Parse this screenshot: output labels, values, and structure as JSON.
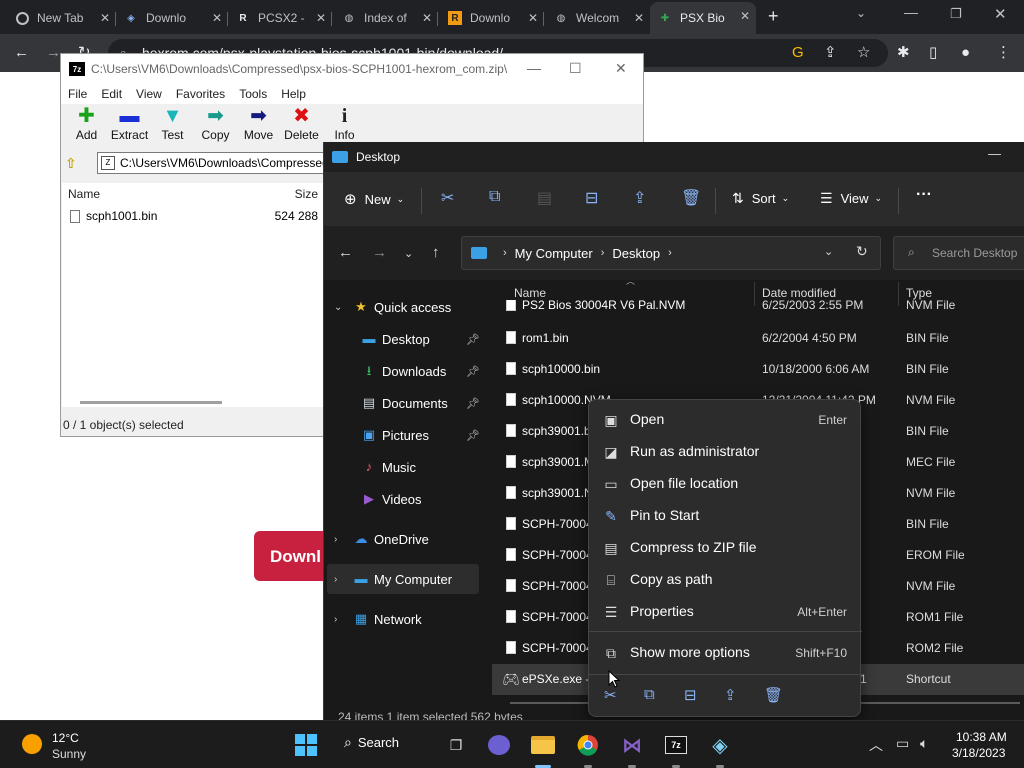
{
  "chrome": {
    "tabs": [
      {
        "label": "New Tab",
        "icon": "chrome-icon"
      },
      {
        "label": "Downlo",
        "icon": "site-icon"
      },
      {
        "label": "PCSX2 -",
        "icon": "r-icon"
      },
      {
        "label": "Index of",
        "icon": "globe-icon"
      },
      {
        "label": "Downlo",
        "icon": "r-icon"
      },
      {
        "label": "Welcom",
        "icon": "globe-icon"
      },
      {
        "label": "PSX Bio",
        "icon": "plugin-icon",
        "active": true
      }
    ],
    "url": "hexrom.com/psx-playstation-bios-scph1001-bin/download/",
    "page_button_label": "Downl"
  },
  "sevenzip": {
    "title": "C:\\Users\\VM6\\Downloads\\Compressed\\psx-bios-SCPH1001-hexrom_com.zip\\",
    "menu": [
      "File",
      "Edit",
      "View",
      "Favorites",
      "Tools",
      "Help"
    ],
    "toolbar": [
      {
        "label": "Add",
        "icon": "add-icon",
        "glyph": "✚",
        "color": "#1aa31a"
      },
      {
        "label": "Extract",
        "icon": "extract-icon",
        "glyph": "▬",
        "color": "#1a2fd6"
      },
      {
        "label": "Test",
        "icon": "test-icon",
        "glyph": "▼",
        "color": "#19b7b7"
      },
      {
        "label": "Copy",
        "icon": "copy-icon",
        "glyph": "➡",
        "color": "#1a9a8a"
      },
      {
        "label": "Move",
        "icon": "move-icon",
        "glyph": "➡",
        "color": "#141a80"
      },
      {
        "label": "Delete",
        "icon": "delete-icon",
        "glyph": "✖",
        "color": "#d11"
      },
      {
        "label": "Info",
        "icon": "info-icon",
        "glyph": "i",
        "color": "#222"
      }
    ],
    "path": "C:\\Users\\VM6\\Downloads\\Compressed",
    "columns": {
      "name": "Name",
      "size": "Size"
    },
    "files": [
      {
        "name": "scph1001.bin",
        "size": "524 288"
      }
    ],
    "status": "0 / 1 object(s) selected"
  },
  "explorer": {
    "title": "Desktop",
    "cmd": {
      "new": "New",
      "sort": "Sort",
      "view": "View"
    },
    "breadcrumb": [
      "My Computer",
      "Desktop"
    ],
    "search_placeholder": "Search Desktop",
    "pane": [
      {
        "label": "Quick access",
        "icon": "star-icon",
        "glyph": "★",
        "color": "#f2c12e"
      },
      {
        "label": "Desktop",
        "icon": "desktop-icon",
        "glyph": "▬",
        "color": "#3ba0e6",
        "pinned": true
      },
      {
        "label": "Downloads",
        "icon": "download-icon",
        "glyph": "⭳",
        "color": "#3cc46b",
        "pinned": true
      },
      {
        "label": "Documents",
        "icon": "documents-icon",
        "glyph": "▤",
        "color": "#cfd8e0",
        "pinned": true
      },
      {
        "label": "Pictures",
        "icon": "pictures-icon",
        "glyph": "▣",
        "color": "#4aa3f0",
        "pinned": true
      },
      {
        "label": "Music",
        "icon": "music-icon",
        "glyph": "♪",
        "color": "#e8627a"
      },
      {
        "label": "Videos",
        "icon": "videos-icon",
        "glyph": "▶",
        "color": "#9b59d0"
      },
      {
        "label": "OneDrive",
        "icon": "cloud-icon",
        "glyph": "☁",
        "color": "#3b8ee8"
      },
      {
        "label": "My Computer",
        "icon": "computer-icon",
        "glyph": "▬",
        "color": "#3ba0e6"
      },
      {
        "label": "Network",
        "icon": "network-icon",
        "glyph": "▦",
        "color": "#3ba0e6"
      }
    ],
    "columns": {
      "name": "Name",
      "date": "Date modified",
      "type": "Type"
    },
    "files": [
      {
        "name": "PS2 Bios 30004R V6 Pal.NVM",
        "date": "6/25/2003 2:55 PM",
        "type": "NVM File"
      },
      {
        "name": "rom1.bin",
        "date": "6/2/2004 4:50 PM",
        "type": "BIN File"
      },
      {
        "name": "scph10000.bin",
        "date": "10/18/2000 6:06 AM",
        "type": "BIN File"
      },
      {
        "name": "scph10000.NVM",
        "date": "12/21/2004 11:42 PM",
        "type": "NVM File"
      },
      {
        "name": "scph39001.b",
        "date": "",
        "type": "BIN File"
      },
      {
        "name": "scph39001.M",
        "date": "",
        "type": "MEC File"
      },
      {
        "name": "scph39001.N",
        "date": "",
        "type": "NVM File"
      },
      {
        "name": "SCPH-70004",
        "date": "",
        "type": "BIN File"
      },
      {
        "name": "SCPH-70004",
        "date": "",
        "type": "EROM File"
      },
      {
        "name": "SCPH-70004",
        "date": "",
        "type": "NVM File"
      },
      {
        "name": "SCPH-70004",
        "date": "",
        "type": "ROM1 File"
      },
      {
        "name": "SCPH-70004",
        "date": "",
        "type": "ROM2 File"
      },
      {
        "name": "ePSXe.exe - S",
        "date": "1",
        "type": "Shortcut"
      }
    ],
    "status": "24 items   1 item selected   562 bytes"
  },
  "context_menu": {
    "items": [
      {
        "label": "Open",
        "shortcut": "Enter",
        "icon": "open-icon",
        "glyph": "▣"
      },
      {
        "label": "Run as administrator",
        "shortcut": "",
        "icon": "shield-icon",
        "glyph": "◪"
      },
      {
        "label": "Open file location",
        "shortcut": "",
        "icon": "folder-icon",
        "glyph": "▭"
      },
      {
        "label": "Pin to Start",
        "shortcut": "",
        "icon": "pin-icon",
        "glyph": "✎"
      },
      {
        "label": "Compress to ZIP file",
        "shortcut": "",
        "icon": "zip-icon",
        "glyph": "▤"
      },
      {
        "label": "Copy as path",
        "shortcut": "",
        "icon": "path-icon",
        "glyph": "⌸"
      },
      {
        "label": "Properties",
        "shortcut": "Alt+Enter",
        "icon": "properties-icon",
        "glyph": "☰"
      },
      {
        "label": "Show more options",
        "shortcut": "Shift+F10",
        "icon": "more-options-icon",
        "glyph": "⧉"
      }
    ]
  },
  "taskbar": {
    "temperature": "12°C",
    "condition": "Sunny",
    "search_label": "Search",
    "time": "10:38 AM",
    "date": "3/18/2023"
  }
}
